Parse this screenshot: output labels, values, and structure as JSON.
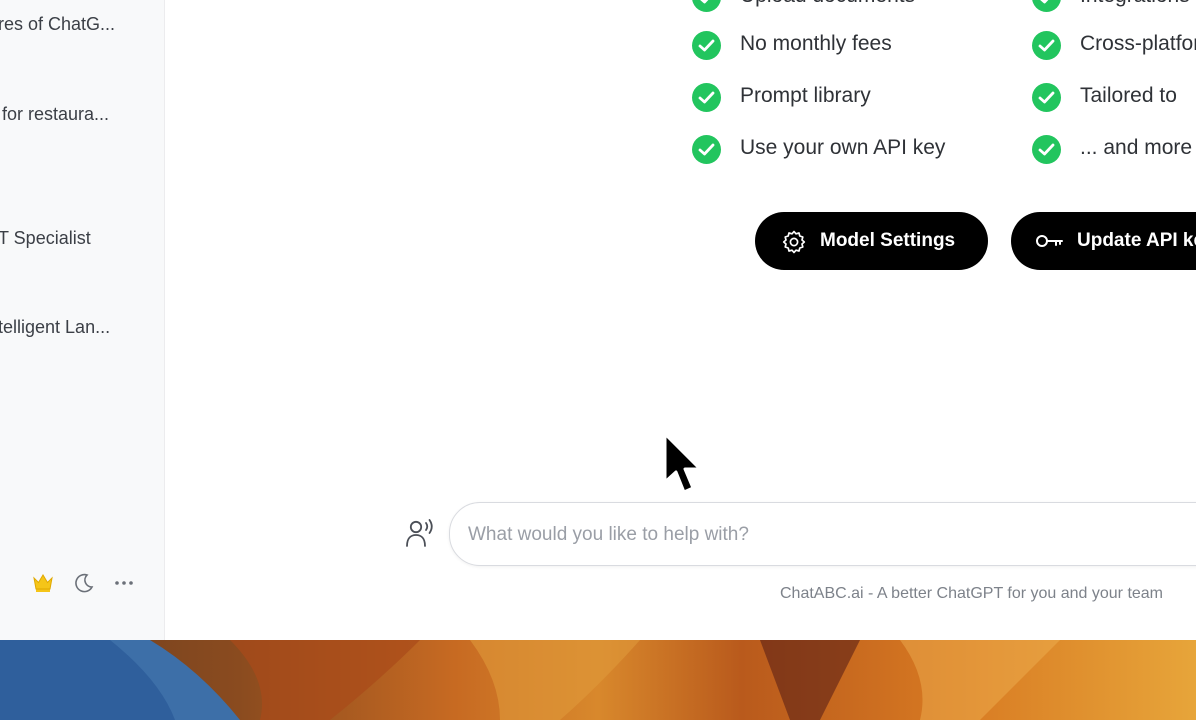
{
  "sidebar": {
    "items": [
      {
        "label": "res of ChatG..."
      },
      {
        "label": "for restaura..."
      },
      {
        "label": "T Specialist"
      },
      {
        "label": "telligent Lan..."
      }
    ],
    "footer_icons": [
      "crown-icon",
      "moon-icon",
      "more-icon"
    ]
  },
  "features": {
    "left": [
      {
        "label": "Upload documents"
      },
      {
        "label": "No monthly fees"
      },
      {
        "label": "Prompt library"
      },
      {
        "label": "Use your own API key"
      }
    ],
    "right": [
      {
        "label": "Integrations"
      },
      {
        "label": "Cross-platform"
      },
      {
        "label": "Tailored to"
      },
      {
        "label": "... and more"
      }
    ]
  },
  "actions": {
    "model_settings": "Model Settings",
    "update_api_key": "Update API key"
  },
  "composer": {
    "placeholder": "What would you like to help with?",
    "voice_icon": "voice-icon"
  },
  "footer_note": "ChatABC.ai - A better ChatGPT for you and your team",
  "colors": {
    "check": "#22c55e",
    "pill": "#000000",
    "crown": "#f5c518"
  }
}
